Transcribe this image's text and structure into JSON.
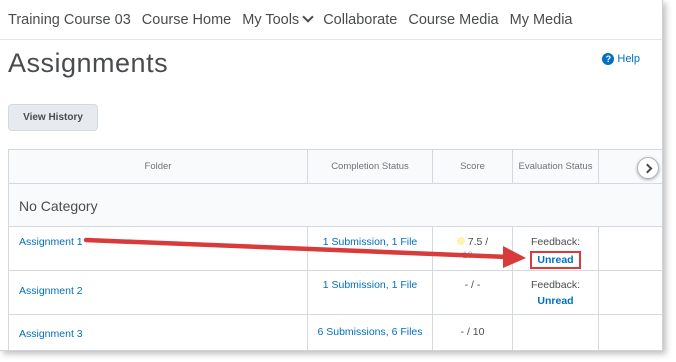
{
  "navbar": {
    "course_name": "Training Course 03",
    "items": [
      "Course Home",
      "My Tools",
      "Collaborate",
      "Course Media",
      "My Media"
    ]
  },
  "page": {
    "title": "Assignments",
    "help_label": "Help",
    "view_history_label": "View History"
  },
  "table": {
    "headers": [
      "Folder",
      "Completion Status",
      "Score",
      "Evaluation Status"
    ],
    "category": "No Category",
    "rows": [
      {
        "name": "Assignment 1",
        "completion": "1 Submission, 1 File",
        "score": "7.5 /",
        "score_sub": "10",
        "eval_label": "Feedback:",
        "eval_value": "Unread"
      },
      {
        "name": "Assignment 2",
        "completion": "1 Submission, 1 File",
        "score": "- / -",
        "eval_label": "Feedback:",
        "eval_value": "Unread"
      },
      {
        "name": "Assignment 3",
        "completion": "6 Submissions, 6 Files",
        "score": "- / 10",
        "eval_label": "",
        "eval_value": ""
      }
    ]
  },
  "colors": {
    "link": "#006fbf",
    "annotation": "#d93a3a"
  },
  "icons": {
    "help": "help-icon",
    "scroll": "chevron-right-icon",
    "my_tools": "chevron-down-icon"
  }
}
